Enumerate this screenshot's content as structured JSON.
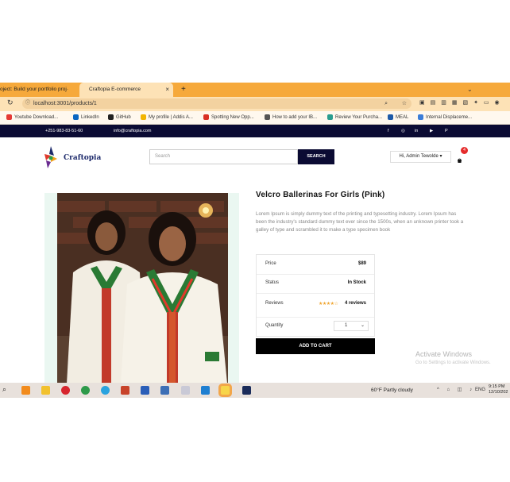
{
  "browser": {
    "tabs": [
      {
        "title": "oject: Build your portfolio proj·",
        "active": false
      },
      {
        "title": "Craftopia E-commerce",
        "active": true
      }
    ],
    "new_tab": "+",
    "address": "localhost:3001/products/1",
    "bookmarks": [
      "Youtube Download...",
      "LinkedIn",
      "GitHub",
      "My profile | Addis A...",
      "Spotting New Opp...",
      "How to add your IB...",
      "Review Your Purcha...",
      "MEAL",
      "Internal Displaceme..."
    ]
  },
  "site": {
    "phone": "+251-983-83-51-60",
    "email": "info@craftopia.com",
    "social": [
      "f",
      "◎",
      "in",
      "▶",
      "P"
    ],
    "logo": "Craftopia",
    "search_placeholder": "Search",
    "search_button": "SEARCH",
    "user_menu": "Hi, Admin Tewolde ▾",
    "cart_count": "4"
  },
  "product": {
    "title": "Velcro Ballerinas For Girls (Pink)",
    "description": "Lorem Ipsum is simply dummy text of the printing and typesetting industry. Lorem Ipsum has been the industry's standard dummy text ever since the 1500s, when an unknown printer took a galley of type and scrambled it to make a type specimen book",
    "price_label": "Price",
    "price": "$89",
    "status_label": "Status",
    "status": "In Stock",
    "reviews_label": "Reviews",
    "rating": 4,
    "stars": "★★★★☆",
    "reviews": "4 reviews",
    "quantity_label": "Quantity",
    "quantity": "1",
    "add_to_cart": "ADD TO CART"
  },
  "os": {
    "watermark_title": "Activate Windows",
    "watermark_sub": "Go to Settings to activate Windows.",
    "weather": "60°F  Partly cloudy",
    "lang": "ENG",
    "time": "9:15 PM",
    "date": "12/10/202"
  },
  "colors": {
    "tabbar": "#f6a93b",
    "navy": "#0b0b33",
    "accent_red": "#e52b2b"
  }
}
